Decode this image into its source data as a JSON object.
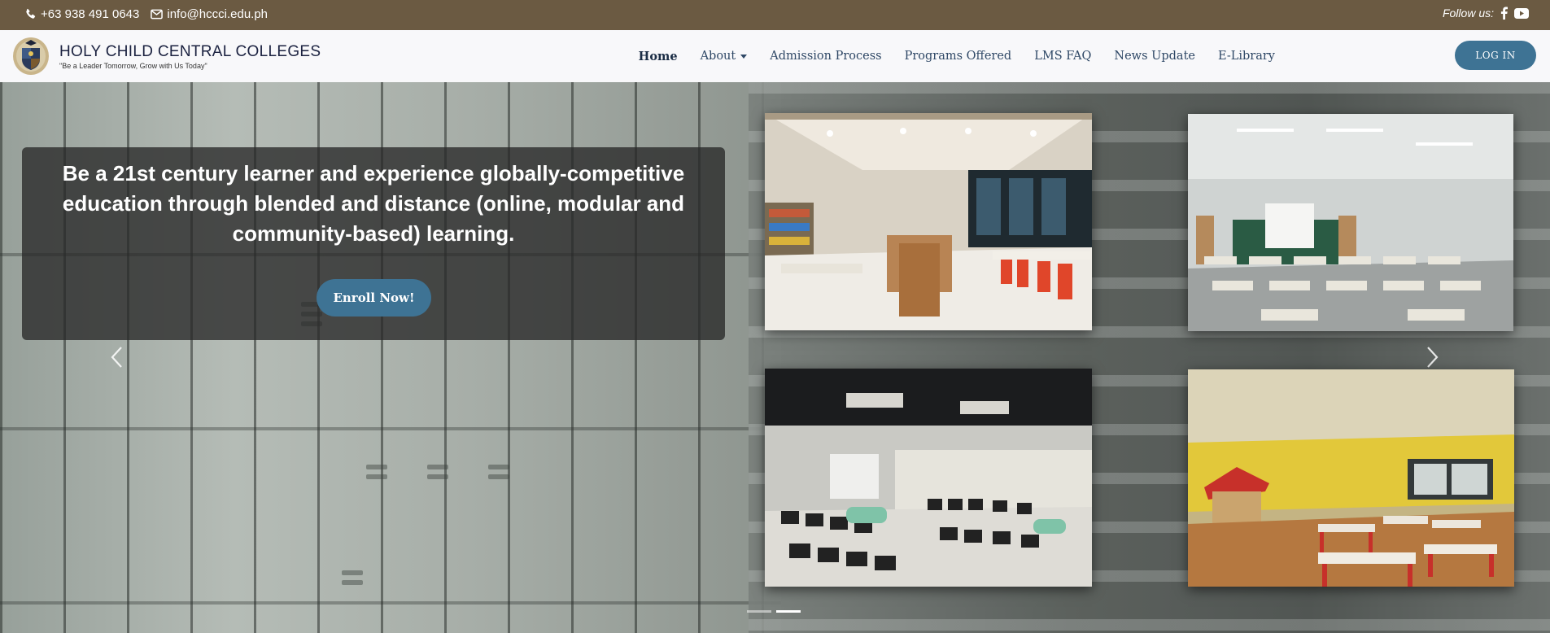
{
  "topbar": {
    "phone": "+63 938 491 0643",
    "email": "info@hccci.edu.ph",
    "follow_label": "Follow us:",
    "bg_color": "#6b5a42",
    "icons": [
      "phone-icon",
      "envelope-icon",
      "facebook-icon",
      "youtube-icon"
    ]
  },
  "header": {
    "school_name": "HOLY CHILD CENTRAL COLLEGES",
    "tagline": "\"Be a Leader Tomorrow, Grow with Us Today\"",
    "nav": [
      {
        "label": "Home",
        "active": true
      },
      {
        "label": "About",
        "dropdown": true
      },
      {
        "label": "Admission Process"
      },
      {
        "label": "Programs Offered"
      },
      {
        "label": "LMS FAQ"
      },
      {
        "label": "News Update"
      },
      {
        "label": "E-Library"
      }
    ],
    "login_label": "LOG IN",
    "accent_color": "#3e7394"
  },
  "hero": {
    "headline": "Be a 21st century learner and experience globally-competitive education through blended and distance (online, modular and community-based) learning.",
    "cta_label": "Enroll Now!",
    "prev_icon": "chevron-left-icon",
    "next_icon": "chevron-right-icon",
    "slide_count": 2,
    "active_slide": 2,
    "photos": [
      "library-photo",
      "classroom-photo",
      "computer-lab-photo",
      "preschool-room-photo"
    ]
  }
}
